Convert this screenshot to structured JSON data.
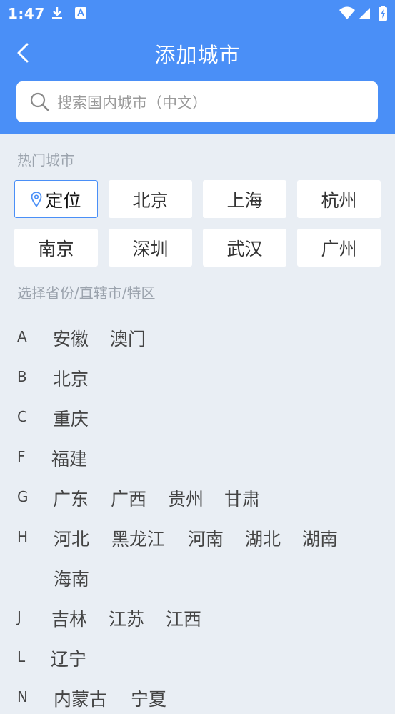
{
  "status_bar": {
    "time": "1:47"
  },
  "header": {
    "title": "添加城市",
    "search_placeholder": "搜索国内城市（中文）"
  },
  "hot_section": {
    "label": "热门城市",
    "locate_label": "定位",
    "cities": [
      "北京",
      "上海",
      "杭州",
      "南京",
      "深圳",
      "武汉",
      "广州"
    ]
  },
  "province_section": {
    "label": "选择省份/直辖市/特区",
    "groups": [
      {
        "letter": "A",
        "items": [
          "安徽",
          "澳门"
        ]
      },
      {
        "letter": "B",
        "items": [
          "北京"
        ]
      },
      {
        "letter": "C",
        "items": [
          "重庆"
        ]
      },
      {
        "letter": "F",
        "items": [
          "福建"
        ]
      },
      {
        "letter": "G",
        "items": [
          "广东",
          "广西",
          "贵州",
          "甘肃"
        ]
      },
      {
        "letter": "H",
        "items": [
          "河北",
          "黑龙江",
          "河南",
          "湖北",
          "湖南",
          "海南"
        ]
      },
      {
        "letter": "J",
        "items": [
          "吉林",
          "江苏",
          "江西"
        ]
      },
      {
        "letter": "L",
        "items": [
          "辽宁"
        ]
      },
      {
        "letter": "N",
        "items": [
          "内蒙古",
          "宁夏"
        ]
      }
    ]
  },
  "colors": {
    "accent": "#4a8ff7",
    "background": "#e9eef4"
  }
}
